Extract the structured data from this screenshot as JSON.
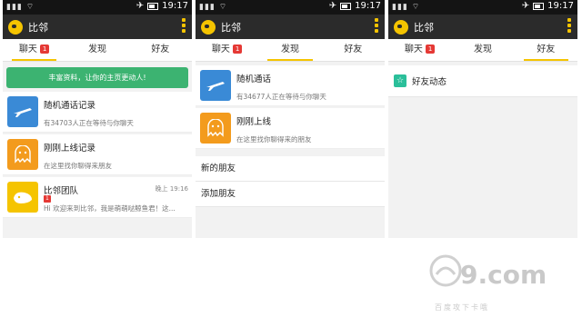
{
  "status": {
    "time": "19:17"
  },
  "app": {
    "title": "比邻"
  },
  "tabs": [
    "聊天",
    "发现",
    "好友"
  ],
  "chat_badge": "1",
  "panel1": {
    "banner": "丰富资料，让你的主页更动人!",
    "items": [
      {
        "title": "随机通话记录",
        "sub": "有34703人正在等待与你聊天"
      },
      {
        "title": "刚刚上线记录",
        "sub": "在这里找你聊得来朋友"
      },
      {
        "title": "比邻团队",
        "time": "晚上 19:16",
        "badge": "1",
        "sub": "Hi 欢迎来到比邻，我是萌萌哒鲸鱼君！这..."
      }
    ]
  },
  "panel2": {
    "items": [
      {
        "title": "随机通话",
        "sub": "有34677人正在等待与你聊天"
      },
      {
        "title": "刚刚上线",
        "sub": "在这里找你聊得来的朋友"
      }
    ],
    "rows": [
      "新的朋友",
      "添加朋友"
    ]
  },
  "panel3": {
    "feed_label": "好友动态"
  },
  "watermark": {
    "brand": "9.com",
    "tagline": "百度攻下卡哦"
  },
  "colors": {
    "accent": "#f5c400",
    "banner": "#3cb371",
    "badge": "#e53935"
  }
}
